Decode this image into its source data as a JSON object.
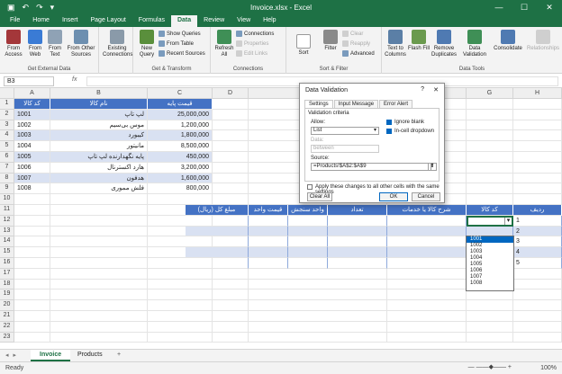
{
  "titlebar": {
    "title": "Invoice.xlsx - Excel"
  },
  "menu": {
    "tabs": [
      "File",
      "Home",
      "Insert",
      "Page Layout",
      "Formulas",
      "Data",
      "Review",
      "View",
      "Help"
    ],
    "active_index": 5
  },
  "ribbon": {
    "get_external": {
      "label": "Get External Data",
      "btns": [
        "From Access",
        "From Web",
        "From Text",
        "From Other Sources"
      ],
      "existing": "Existing Connections"
    },
    "get_transform": {
      "label": "Get & Transform",
      "new_query": "New Query",
      "items": [
        "Show Queries",
        "From Table",
        "Recent Sources"
      ]
    },
    "connections": {
      "label": "Connections",
      "refresh": "Refresh All",
      "items": [
        "Connections",
        "Properties",
        "Edit Links"
      ]
    },
    "sort_filter": {
      "label": "Sort & Filter",
      "sort": "Sort",
      "filter": "Filter",
      "items": [
        "Clear",
        "Reapply",
        "Advanced"
      ]
    },
    "data_tools": {
      "label": "Data Tools",
      "btns": [
        "Text to Columns",
        "Flash Fill",
        "Remove Duplicates",
        "Data Validation",
        "Consolidate",
        "Relationships"
      ]
    }
  },
  "formula_bar": {
    "namebox": "B3",
    "fx": "fx",
    "value": ""
  },
  "columns": [
    "A",
    "B",
    "C",
    "D",
    "E",
    "F",
    "G",
    "H"
  ],
  "rows": [
    "1",
    "2",
    "3",
    "4",
    "5",
    "6",
    "7",
    "8",
    "9",
    "10",
    "11",
    "12",
    "13",
    "14",
    "15",
    "16",
    "17",
    "18",
    "19",
    "20",
    "21",
    "22",
    "23"
  ],
  "products": {
    "headers": [
      "کد کالا",
      "نام کالا",
      "قیمت پایه"
    ],
    "items": [
      [
        "1001",
        "لپ تاپ",
        "25,000,000"
      ],
      [
        "1002",
        "موس بی‌سیم",
        "1,200,000"
      ],
      [
        "1003",
        "کیبورد",
        "1,800,000"
      ],
      [
        "1004",
        "مانیتور",
        "8,500,000"
      ],
      [
        "1005",
        "پایه نگهدارنده لپ تاپ",
        "450,000"
      ],
      [
        "1006",
        "هارد اکسترنال",
        "3,200,000"
      ],
      [
        "1007",
        "هدفون",
        "1,600,000"
      ],
      [
        "1008",
        "فلش مموری",
        "800,000"
      ]
    ]
  },
  "invoice": {
    "headers": [
      "ردیف",
      "کد کالا",
      "شرح کالا یا خدمات",
      "تعداد",
      "واحد سنجش",
      "قیمت واحد",
      "مبلغ کل (ریال)"
    ],
    "row_numbers": [
      "1",
      "2",
      "3",
      "4",
      "5"
    ]
  },
  "dialog": {
    "title": "Data Validation",
    "help": "?",
    "close": "✕",
    "tabs": [
      "Settings",
      "Input Message",
      "Error Alert"
    ],
    "criteria_label": "Validation criteria",
    "allow_label": "Allow:",
    "allow_value": "List",
    "data_label": "Data:",
    "data_value": "between",
    "ignore_blank": "Ignore blank",
    "in_cell_dropdown": "In-cell dropdown",
    "source_label": "Source:",
    "source_value": "=Products!$A$2:$A$9",
    "apply_all": "Apply these changes to all other cells with the same settings",
    "clear_all": "Clear All",
    "ok": "OK",
    "cancel": "Cancel"
  },
  "dropdown": {
    "items": [
      "1001",
      "1002",
      "1003",
      "1004",
      "1005",
      "1006",
      "1007",
      "1008"
    ],
    "selected_index": 0
  },
  "sheets": {
    "tabs": [
      "Invoice",
      "Products"
    ],
    "active_index": 0,
    "add": "+"
  },
  "status": {
    "ready": "Ready",
    "zoom": "100%"
  }
}
